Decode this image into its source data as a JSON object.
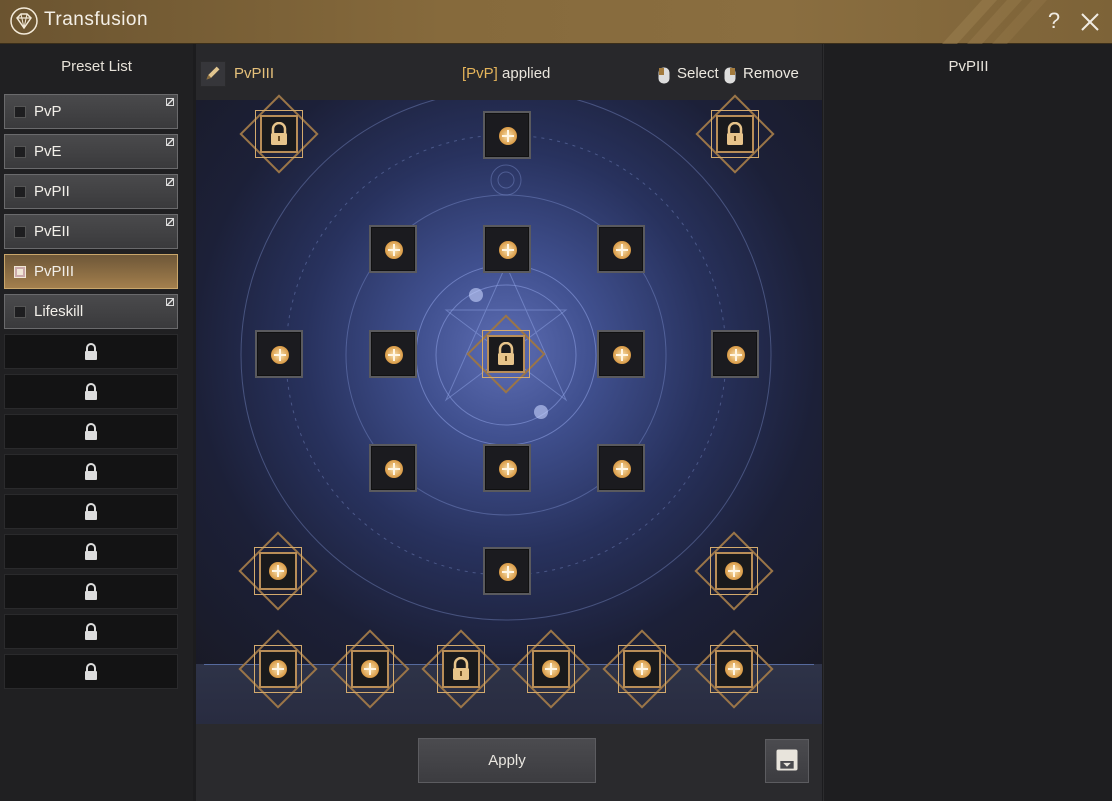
{
  "window": {
    "title": "Transfusion",
    "help_label": "?"
  },
  "preset_list": {
    "header": "Preset List",
    "items": [
      {
        "label": "PvP",
        "active": false
      },
      {
        "label": "PvE",
        "active": false
      },
      {
        "label": "PvPII",
        "active": false
      },
      {
        "label": "PvEII",
        "active": false
      },
      {
        "label": "PvPIII",
        "active": true
      },
      {
        "label": "Lifeskill",
        "active": false
      }
    ],
    "locked_slots": 9
  },
  "center": {
    "preset_name": "PvPIII",
    "applied_tag": "[PvP]",
    "applied_text": " applied",
    "select_label": "Select",
    "remove_label": "Remove",
    "apply_label": "Apply"
  },
  "right_panel": {
    "title": "PvPIII"
  },
  "colors": {
    "accent_gold": "#e5c07a",
    "applied_tag": "#e5b45a"
  },
  "icons": [
    "gem-logo-icon",
    "help-icon",
    "close-icon",
    "pencil-icon",
    "lock-icon",
    "plus-icon",
    "mouse-left-icon",
    "mouse-right-icon",
    "save-icon",
    "hand-cursor-icon"
  ]
}
